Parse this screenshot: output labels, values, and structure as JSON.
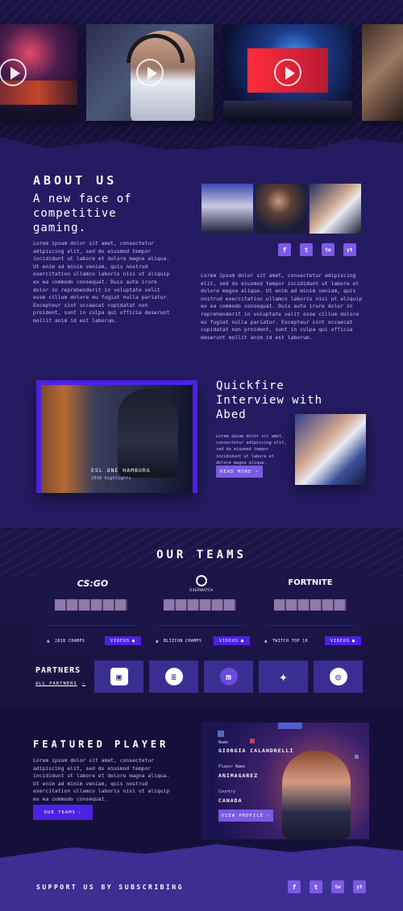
{
  "about": {
    "heading": "ABOUT US",
    "subheading_line1": "A new face of",
    "subheading_line2": "competitive",
    "subheading_line3": "gaming.",
    "para_left": "Lorem ipsum dolor sit amet, consectetur adipiscing elit, sed do eiusmod tempor incididunt ut labore et dolore magna aliqua. Ut enim ad minim veniam, quis nostrud exercitation ullamco laboris nisi ut aliquip ex ea commodo consequat. Duis aute irure dolor in reprehenderit in voluptate velit esse cillum dolore eu fugiat nulla pariatur. Excepteur sint occaecat cupidatat non proident, sunt in culpa qui officia deserunt mollit anim id est laborum.",
    "para_right": "Lorem ipsum dolor sit amet, consectetur adipiscing elit, sed do eiusmod tempor incididunt ut labore et dolore magna aliqua. Ut enim ad minim veniam, quis nostrud exercitation ullamco laboris nisi ut aliquip ex ea commodo consequat. Duis aute irure dolor in reprehenderit in voluptate velit esse cillum dolore eu fugiat nulla pariatur. Excepteur sint occaecat cupidatat non proident, sunt in culpa qui officia deserunt mollit anim id est laborum."
  },
  "interview": {
    "video_title": "ESL ONE HAMBURG",
    "video_subtitle": "2018 highlights",
    "heading_line1": "Quickfire",
    "heading_line2": "Interview with",
    "heading_line3": "Abed",
    "text": "Lorem ipsum dolor sit amet, consectetur adipiscing elit, sed do eiusmod tempor incididunt ut labore et dolore magna aliqua.",
    "button": "READ MORE"
  },
  "teams": {
    "heading": "OUR TEAMS",
    "cards": [
      {
        "logo": "CS:GO",
        "badge": "2018 CHAMPS",
        "button": "VIDEOS"
      },
      {
        "logo": "OVERWATCH",
        "badge": "BLIZCON CHAMPS",
        "button": "VIDEOS"
      },
      {
        "logo": "FORTNITE",
        "badge": "TWITCH TOP 10",
        "button": "VIDEOS"
      }
    ]
  },
  "partners": {
    "heading": "PARTNERS",
    "link": "ALL PARTNERS"
  },
  "featured": {
    "heading": "FEATURED PLAYER",
    "text": "Lorem ipsum dolor sit amet, consectetur adipiscing elit, sed do eiusmod tempor incididunt ut labore et dolore magna aliqua. Ut enim ad minim veniam, quis nostrud exercitation ullamco laboris nisi ut aliquip ex ea commodo consequat.",
    "button": "OUR TEAMS",
    "name_label": "Name",
    "name_value": "GIORGIA CALANDRELLI",
    "player_label": "Player Name",
    "player_value": "ANIMAGAREZ",
    "country_label": "Country",
    "country_value": "CANADA",
    "profile_button": "VIEW PROFILE"
  },
  "footer": {
    "subscribe": "SUPPORT US BY SUBSCRIBING"
  },
  "social": {
    "facebook": "f",
    "twitter": "t",
    "twitch": "tw",
    "youtube": "yt"
  },
  "colors": {
    "accent": "#7b5ae6",
    "button_dark": "#4d21e0",
    "background": "#1e1650"
  }
}
